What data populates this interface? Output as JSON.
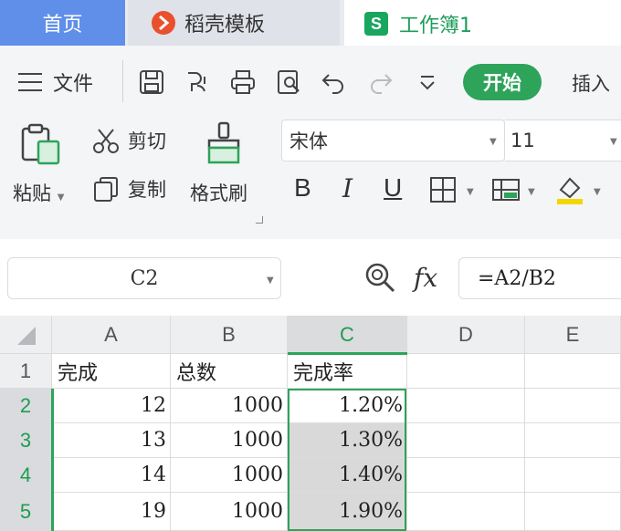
{
  "tabs": {
    "home": "首页",
    "template": "稻壳模板",
    "workbook": "工作簿1",
    "workbook_logo": "S"
  },
  "menu": {
    "file": "文件",
    "start": "开始",
    "insert": "插入"
  },
  "clipboard": {
    "paste": "粘贴",
    "cut": "剪切",
    "copy": "复制",
    "format_painter": "格式刷"
  },
  "font": {
    "name": "宋体",
    "size": "11"
  },
  "formula_bar": {
    "cell_ref": "C2",
    "fx": "fx",
    "formula": "=A2/B2"
  },
  "sheet": {
    "columns": [
      "A",
      "B",
      "C",
      "D",
      "E"
    ],
    "rows": [
      {
        "num": "1",
        "a": "完成",
        "b": "总数",
        "c": "完成率"
      },
      {
        "num": "2",
        "a": "12",
        "b": "1000",
        "c": "1.20%"
      },
      {
        "num": "3",
        "a": "13",
        "b": "1000",
        "c": "1.30%"
      },
      {
        "num": "4",
        "a": "14",
        "b": "1000",
        "c": "1.40%"
      },
      {
        "num": "5",
        "a": "19",
        "b": "1000",
        "c": "1.90%"
      }
    ]
  },
  "colors": {
    "accent": "#2ea35a",
    "home_tab": "#5f8fe9",
    "template_logo": "#e8502e"
  }
}
